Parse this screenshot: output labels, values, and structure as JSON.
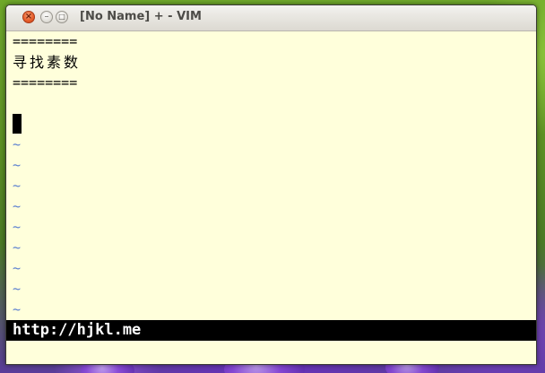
{
  "window": {
    "title": "[No Name] + - VIM",
    "close_glyph": "×",
    "minimize_glyph": "–",
    "maximize_glyph": "□"
  },
  "buffer": {
    "lines": [
      "========",
      "寻找素数",
      "========",
      ""
    ],
    "empty_line_marker": "~",
    "empty_line_count": 9
  },
  "statusline": {
    "text": "http://hjkl.me"
  },
  "colors": {
    "background": "#ffffdb",
    "text": "#000000",
    "tilde": "#5a7fd0",
    "statusline_bg": "#000000",
    "statusline_fg": "#ffffff"
  }
}
